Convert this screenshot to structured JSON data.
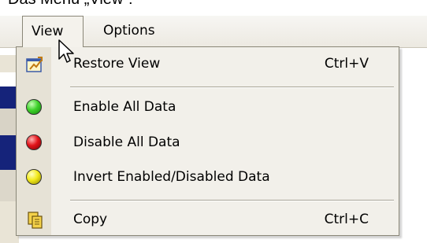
{
  "caption": "Das Menü „View“:",
  "menubar": {
    "items": [
      {
        "label": "View"
      },
      {
        "label": "Options"
      }
    ]
  },
  "menu": {
    "items": [
      {
        "label": "Restore View",
        "shortcut": "Ctrl+V",
        "icon": "restore-view-icon"
      },
      {
        "label": "Enable All Data",
        "icon": "green-dot-icon"
      },
      {
        "label": "Disable All Data",
        "icon": "red-dot-icon"
      },
      {
        "label": "Invert Enabled/Disabled Data",
        "icon": "yellow-dot-icon"
      },
      {
        "label": "Copy",
        "shortcut": "Ctrl+C",
        "icon": "copy-icon"
      }
    ]
  },
  "colors": {
    "enable": "#3fd22b",
    "disable": "#e2141a",
    "invert": "#f3ea1b",
    "titlebar_bg": "#15237a"
  }
}
